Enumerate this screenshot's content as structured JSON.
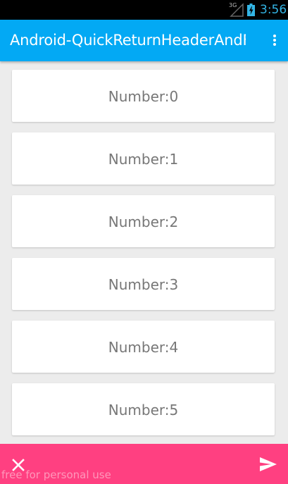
{
  "status_bar": {
    "network_type": "3G",
    "time": "3:56"
  },
  "action_bar": {
    "title": "Android-QuickReturnHeaderAndF.",
    "overflow_icon": "overflow-menu-icon"
  },
  "list": {
    "items": [
      {
        "label": "Number:0"
      },
      {
        "label": "Number:1"
      },
      {
        "label": "Number:2"
      },
      {
        "label": "Number:3"
      },
      {
        "label": "Number:4"
      },
      {
        "label": "Number:5"
      }
    ]
  },
  "bottom_bar": {
    "color": "#ff4081",
    "close_icon": "close-icon",
    "send_icon": "send-icon",
    "watermark": "free for personal use"
  },
  "colors": {
    "primary": "#03a9f4",
    "accent": "#ff4081",
    "status_accent": "#33b5e5"
  }
}
